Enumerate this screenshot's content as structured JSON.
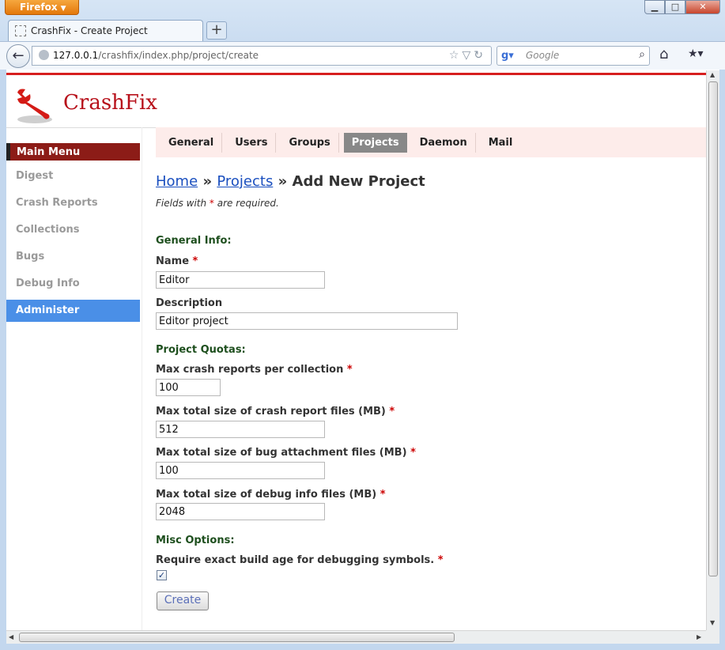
{
  "browser": {
    "app_button": "Firefox",
    "tab_title": "CrashFix - Create Project",
    "url_host": "127.0.0.1",
    "url_path": "/crashfix/index.php/project/create",
    "search_placeholder": "Google",
    "window_controls": {
      "minimize": "▭",
      "maximize": "□",
      "close": "✕"
    }
  },
  "site": {
    "logo_text": "CrashFix",
    "accent_color": "#d71f1f",
    "logo_color": "#b7101a"
  },
  "sidebar": {
    "title": "Main Menu",
    "items": [
      {
        "label": "Digest"
      },
      {
        "label": "Crash Reports"
      },
      {
        "label": "Collections"
      },
      {
        "label": "Bugs"
      },
      {
        "label": "Debug Info"
      },
      {
        "label": "Administer",
        "active": true
      }
    ]
  },
  "submenu": {
    "items": [
      {
        "label": "General"
      },
      {
        "label": "Users"
      },
      {
        "label": "Groups"
      },
      {
        "label": "Projects",
        "active": true
      },
      {
        "label": "Daemon"
      },
      {
        "label": "Mail"
      }
    ]
  },
  "breadcrumb": {
    "home": "Home",
    "sep": "»",
    "projects": "Projects",
    "current": "Add New Project"
  },
  "form": {
    "required_note_prefix": "Fields with ",
    "required_star": "*",
    "required_note_suffix": " are required.",
    "general_title": "General Info:",
    "name_label": "Name",
    "name_value": "Editor",
    "description_label": "Description",
    "description_value": "Editor project",
    "quotas_title": "Project Quotas:",
    "max_reports_label": "Max crash reports per collection",
    "max_reports_value": "100",
    "max_report_size_label": "Max total size of crash report files (MB)",
    "max_report_size_value": "512",
    "max_bug_size_label": "Max total size of bug attachment files (MB)",
    "max_bug_size_value": "100",
    "max_debug_size_label": "Max total size of debug info files (MB)",
    "max_debug_size_value": "2048",
    "misc_title": "Misc Options:",
    "exact_build_label": "Require exact build age for debugging symbols.",
    "exact_build_checked": true,
    "checkmark": "✓",
    "submit_label": "Create"
  }
}
